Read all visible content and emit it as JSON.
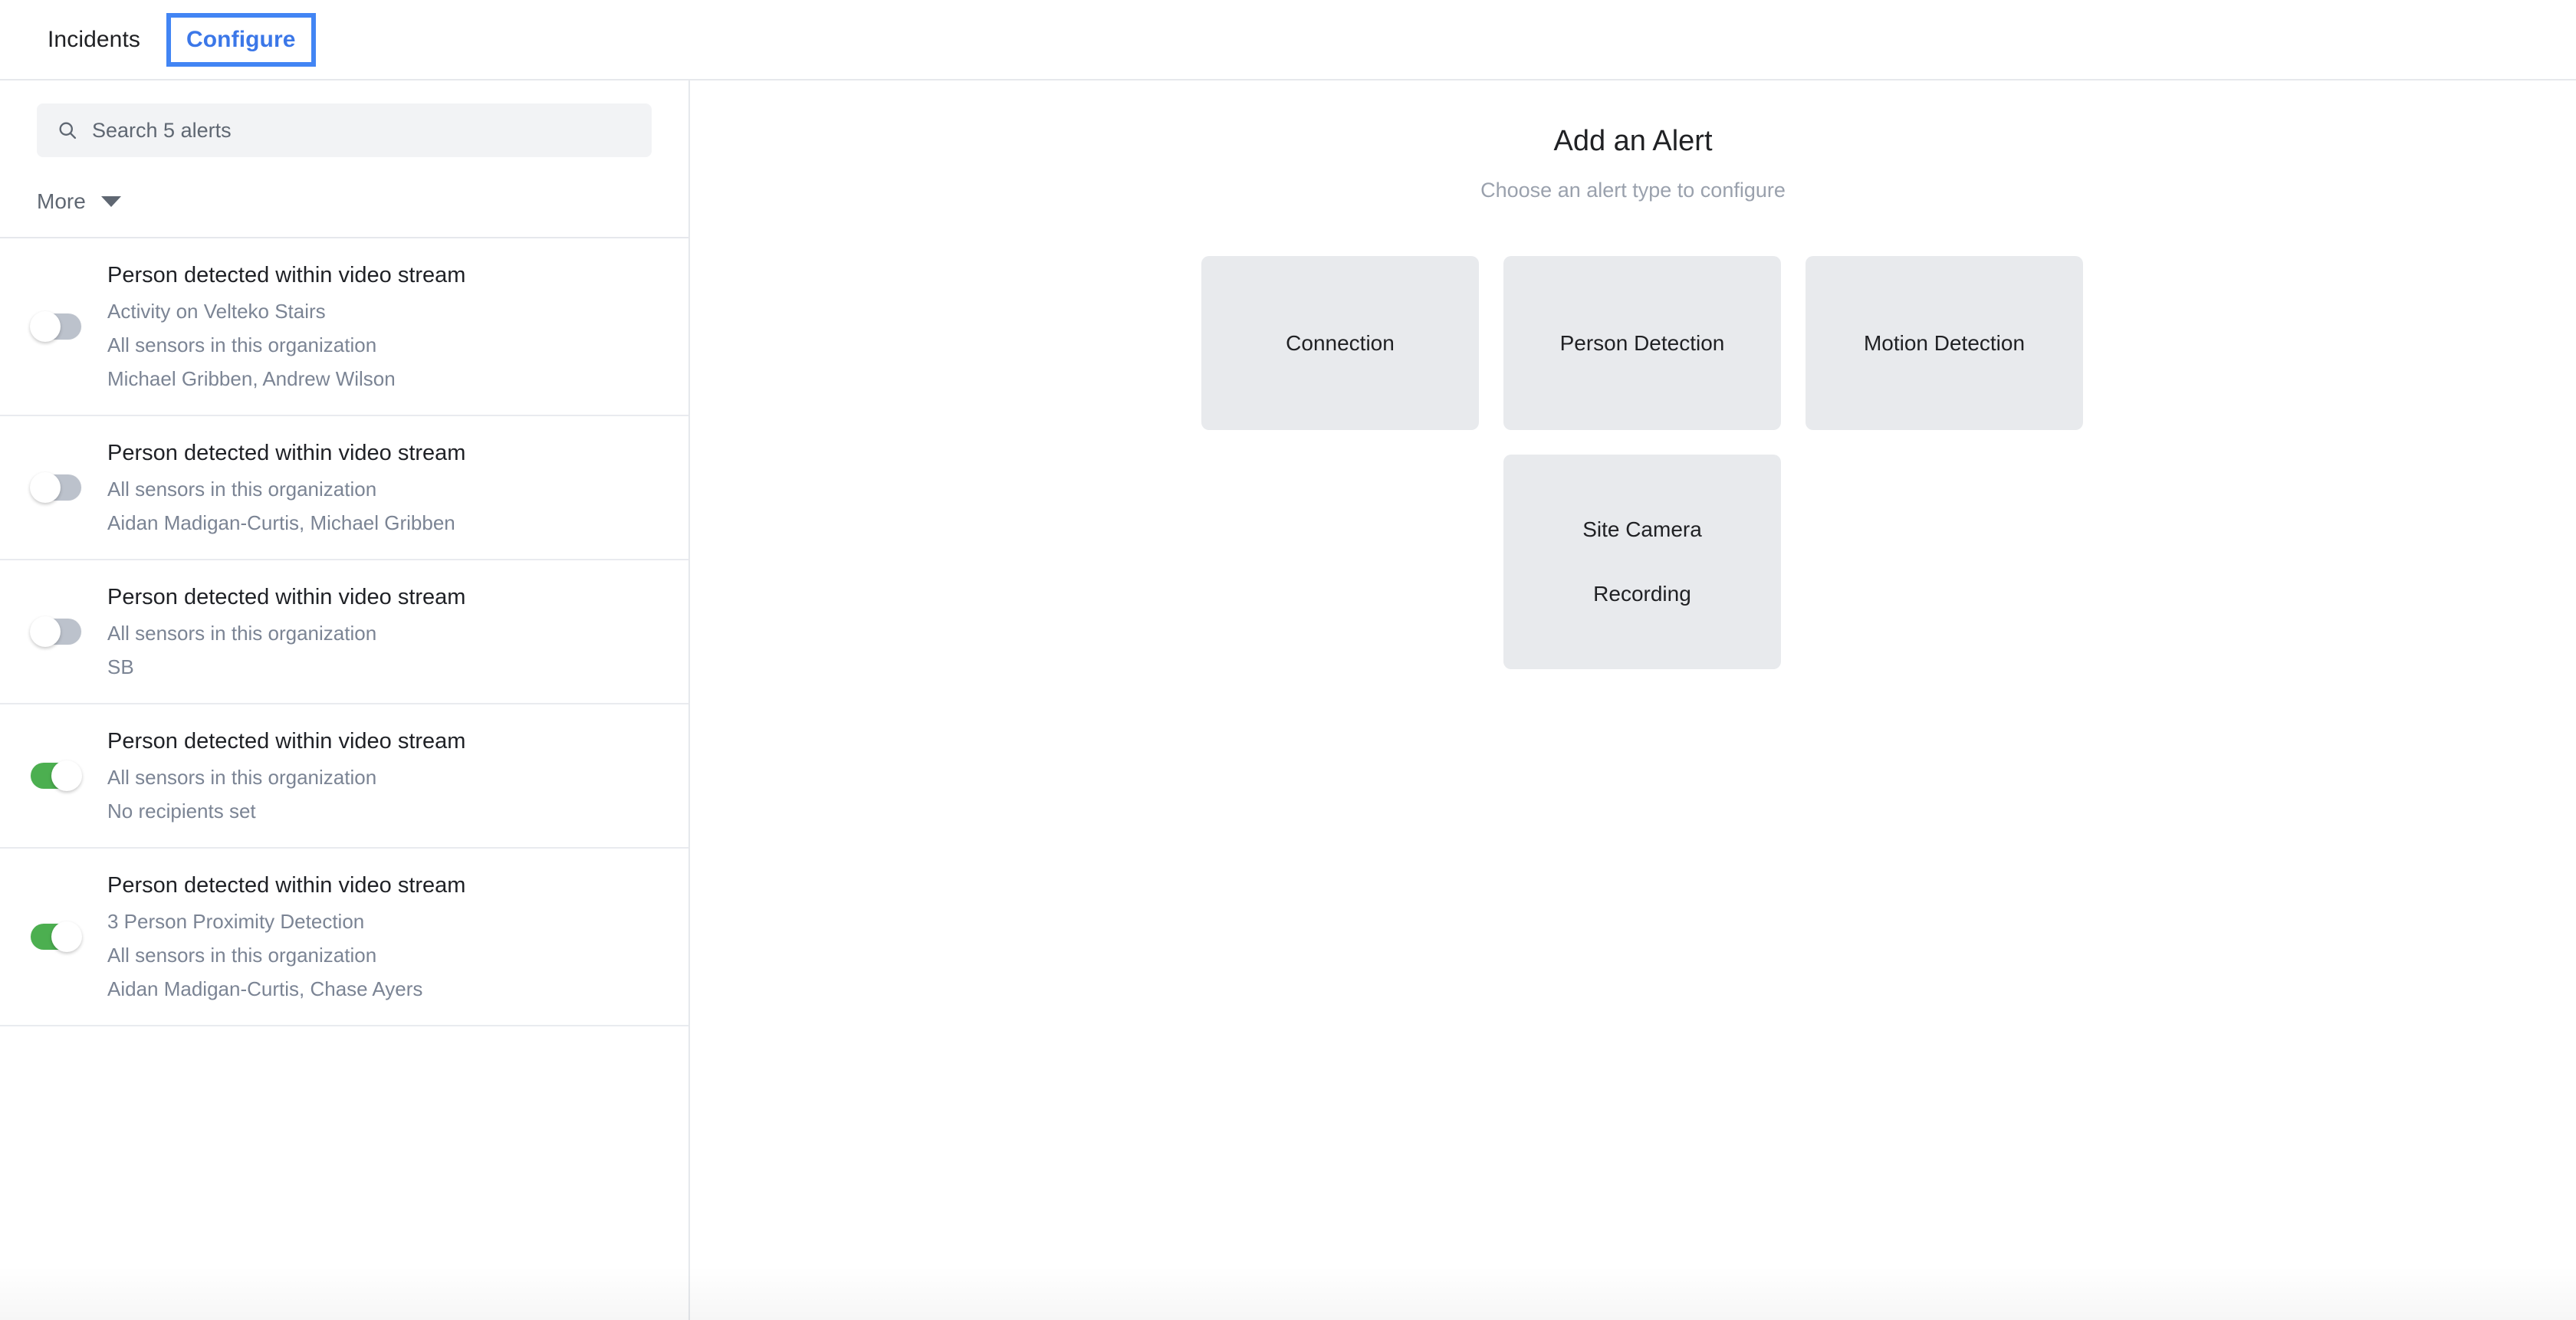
{
  "nav": {
    "tabs": [
      {
        "label": "Incidents",
        "active": false
      },
      {
        "label": "Configure",
        "active": true
      }
    ]
  },
  "sidebar": {
    "search": {
      "icon": "search-icon",
      "placeholder": "Search 5 alerts",
      "value": ""
    },
    "filter": {
      "label": "More",
      "icon": "chevron-down-icon"
    },
    "alerts": [
      {
        "enabled": false,
        "title": "Person detected within video stream",
        "subtitles": [
          "Activity on Velteko Stairs",
          "All sensors in this organization",
          "Michael Gribben, Andrew Wilson"
        ]
      },
      {
        "enabled": false,
        "title": "Person detected within video stream",
        "subtitles": [
          "All sensors in this organization",
          "Aidan Madigan-Curtis, Michael Gribben"
        ]
      },
      {
        "enabled": false,
        "title": "Person detected within video stream",
        "subtitles": [
          "All sensors in this organization",
          "SB"
        ]
      },
      {
        "enabled": true,
        "title": "Person detected within video stream",
        "subtitles": [
          "All sensors in this organization",
          "No recipients set"
        ]
      },
      {
        "enabled": true,
        "title": "Person detected within video stream",
        "subtitles": [
          "3 Person Proximity Detection",
          "All sensors in this organization",
          "Aidan Madigan-Curtis, Chase Ayers"
        ]
      }
    ]
  },
  "main": {
    "title": "Add an Alert",
    "subtitle": "Choose an alert type to configure",
    "cards": [
      {
        "lines": [
          "Connection"
        ]
      },
      {
        "lines": [
          "Person Detection"
        ]
      },
      {
        "lines": [
          "Motion Detection"
        ]
      },
      {
        "lines": [
          "Site Camera",
          "Recording"
        ]
      }
    ]
  },
  "colors": {
    "accent_blue": "#4285f4",
    "tab_blue": "#3b77e8",
    "toggle_on_green": "#4caf50",
    "toggle_off_grey": "#bcc2cc",
    "card_grey": "#e8eaed",
    "search_grey": "#f2f3f5",
    "muted_text": "#7b8494",
    "border_grey": "#e6e8ec"
  }
}
